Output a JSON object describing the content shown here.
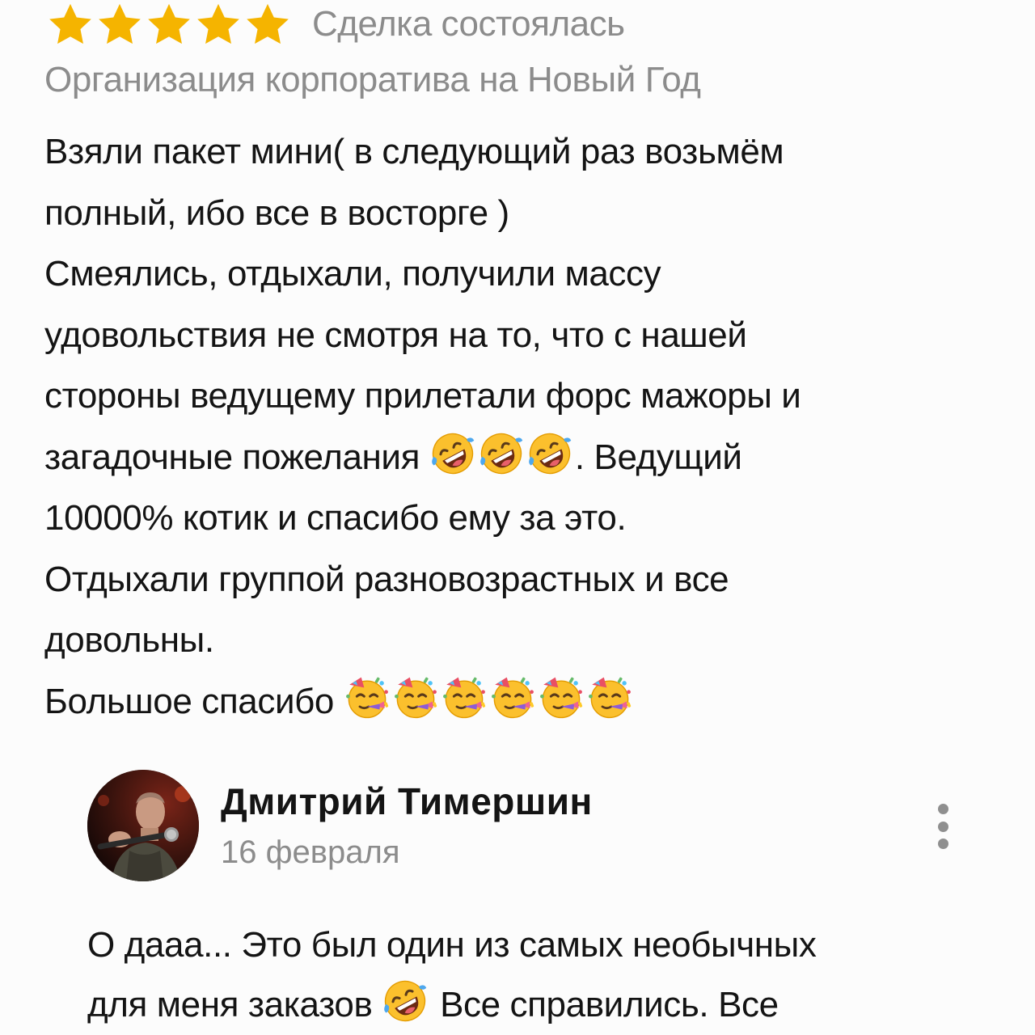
{
  "review": {
    "rating": 5,
    "rating_max": 5,
    "star_color": "#f5b400",
    "status": "Сделка состоялась",
    "service": "Организация корпоратива на Новый Год",
    "lines": {
      "l1": "Взяли пакет мини( в следующий раз возьмём",
      "l2": "полный, ибо все в восторге )",
      "l3": "Смеялись, отдыхали, получили массу",
      "l4": "удовольствия не смотря на то, что с нашей",
      "l5": "стороны ведущему прилетали форс мажоры и",
      "l6a": "загадочные пожелания ",
      "l6b": ". Ведущий",
      "l7": "10000% котик и спасибо ему за это.",
      "l8": "Отдыхали группой разновозрастных и все",
      "l9": "довольны.",
      "l10": "Большое спасибо "
    }
  },
  "reply": {
    "author": "Дмитрий Тимершин",
    "date": "16 февраля",
    "lines": {
      "l1": "О дааа... Это был один из самых необычных",
      "l2a": "для меня заказов ",
      "l2b": " Все справились. Все"
    }
  },
  "icons": {
    "star": "star-icon",
    "laughing": "rolling-on-floor-laughing-emoji",
    "party": "partying-face-emoji",
    "more": "more-vertical-icon"
  }
}
